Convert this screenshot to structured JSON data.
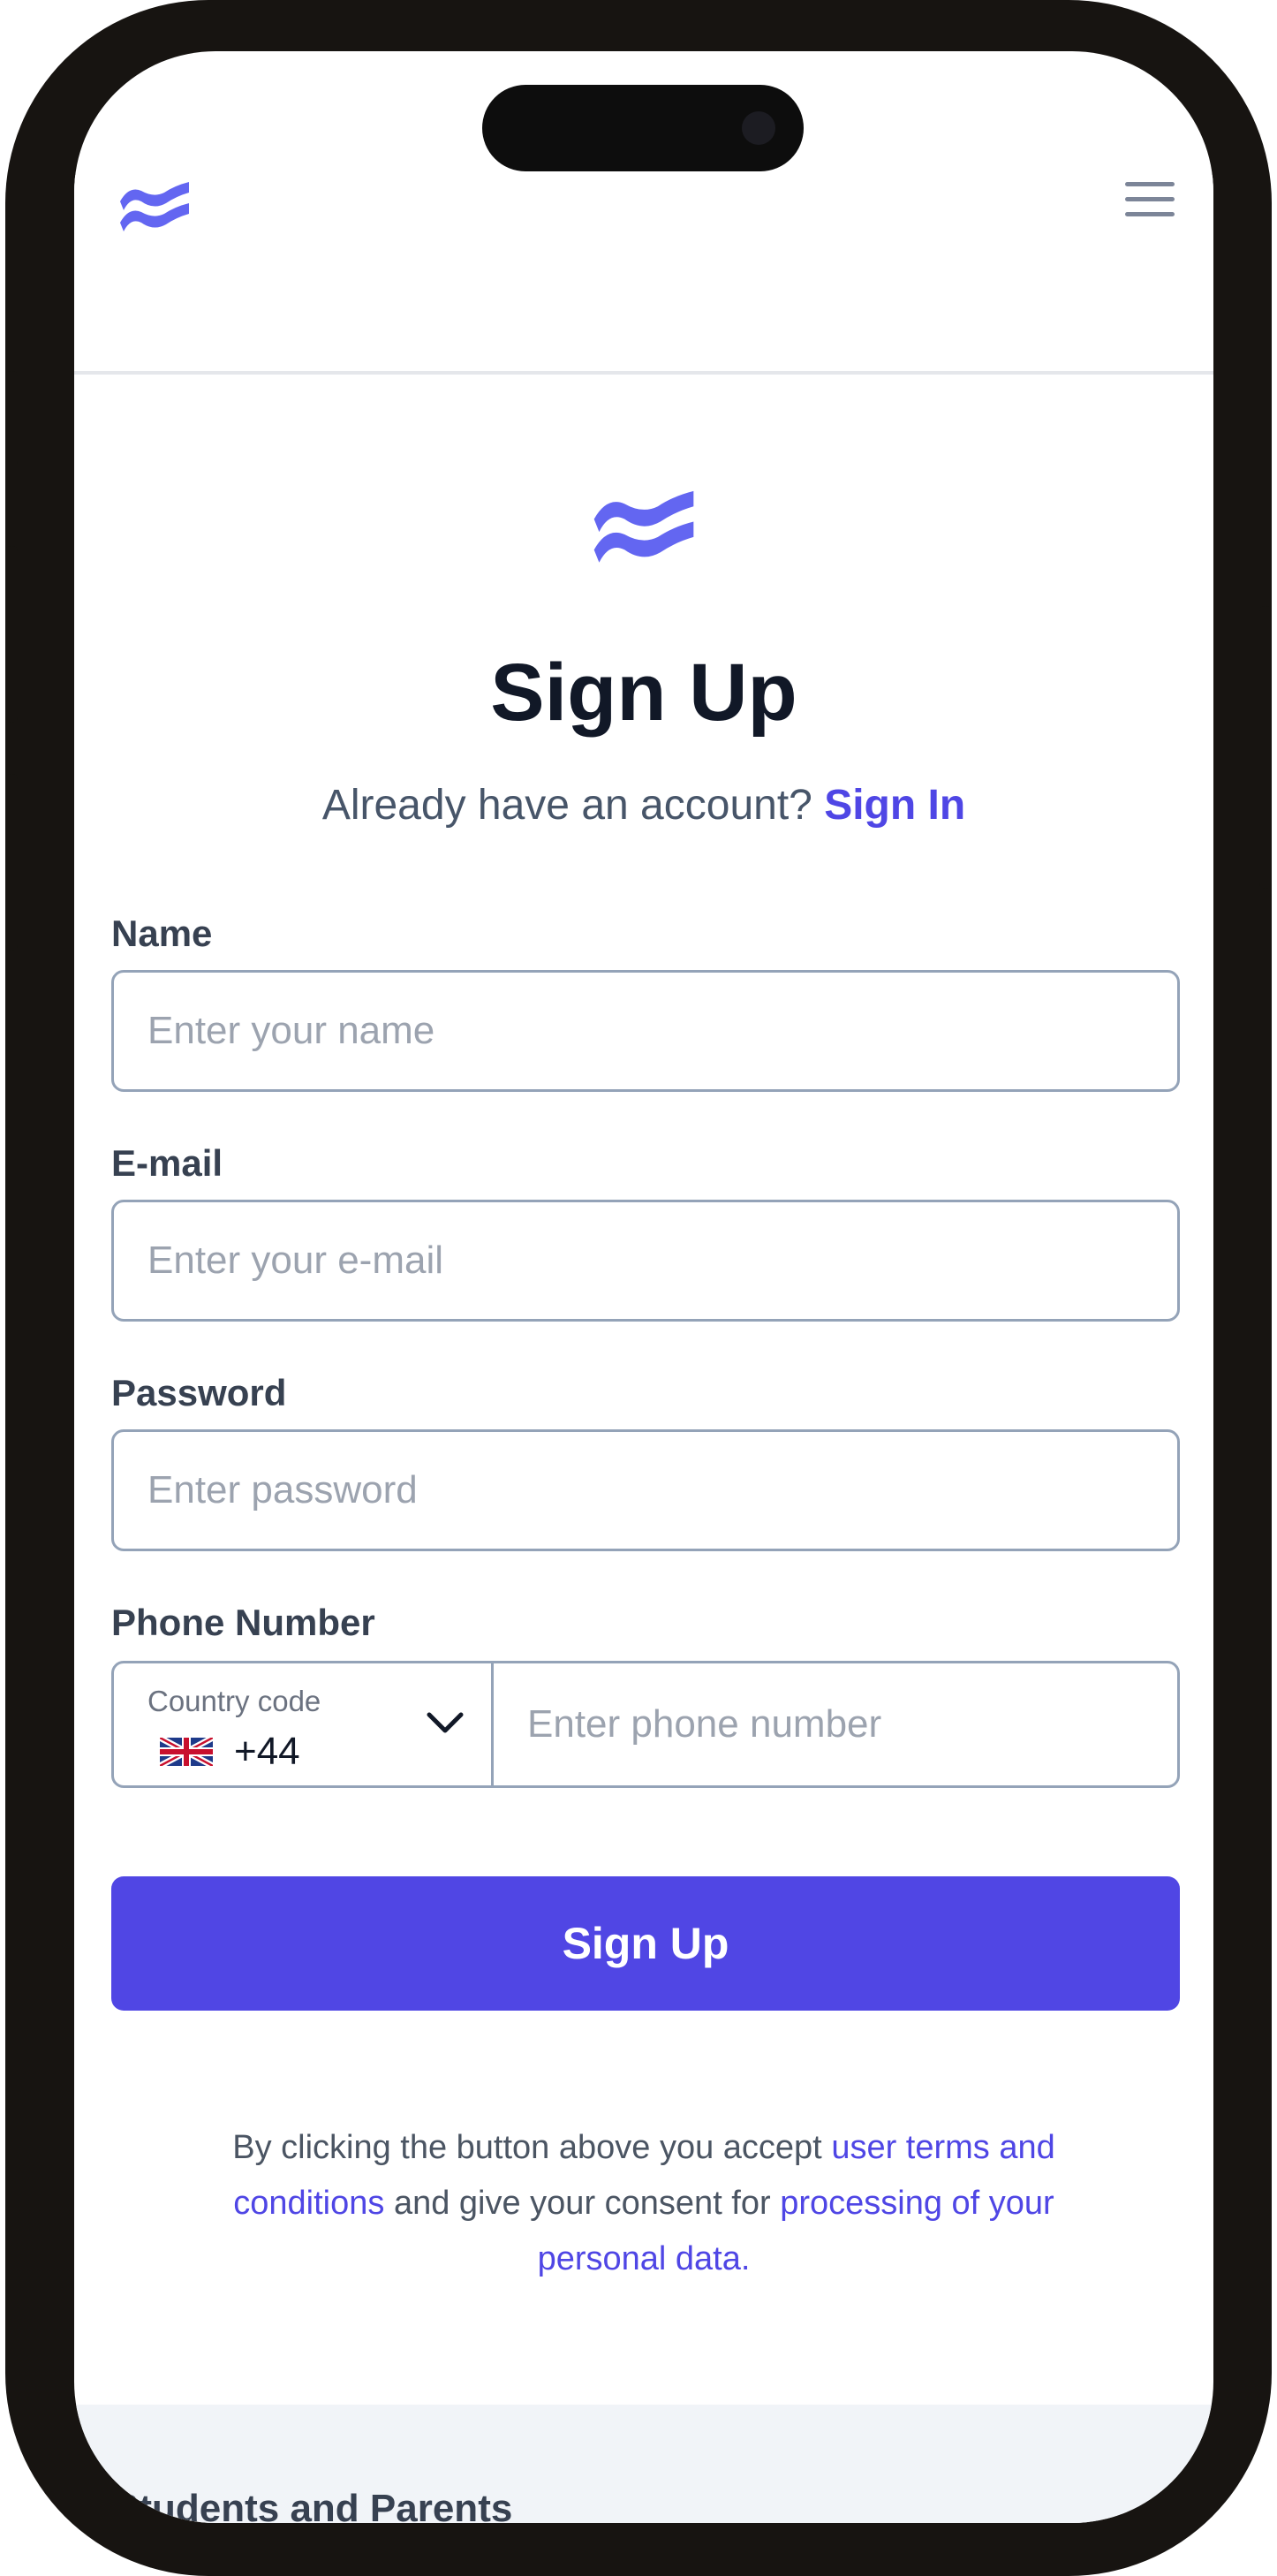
{
  "colors": {
    "accent": "#4f46e5",
    "button_bg": "#5046e4",
    "logo": "#6366f1",
    "title": "#111827",
    "muted_text": "#475569",
    "input_border": "#94a3b8",
    "placeholder": "#9ca3af",
    "footer_bg": "#f1f4f8"
  },
  "header": {
    "logo_icon": "wave-logo-icon",
    "menu_icon": "hamburger-menu-icon"
  },
  "main": {
    "logo_icon": "wave-logo-icon",
    "title": "Sign Up",
    "signin_prompt": "Already have an account?",
    "signin_link": "Sign In"
  },
  "form": {
    "name": {
      "label": "Name",
      "placeholder": "Enter your name",
      "value": ""
    },
    "email": {
      "label": "E-mail",
      "placeholder": "Enter your e-mail",
      "value": ""
    },
    "password": {
      "label": "Password",
      "placeholder": "Enter password",
      "value": ""
    },
    "phone": {
      "label": "Phone Number",
      "country_label": "Country code",
      "country_flag_icon": "uk-flag-icon",
      "country_code": "+44",
      "chevron_icon": "chevron-down-icon",
      "placeholder": "Enter phone number",
      "value": ""
    },
    "submit_label": "Sign Up"
  },
  "legal": {
    "text_1": "By clicking the button above you accept ",
    "link_1": "user terms and conditions",
    "text_2": " and give your consent for ",
    "link_2": "processing of your personal data."
  },
  "footer": {
    "partial_text": "Students and Parents"
  }
}
